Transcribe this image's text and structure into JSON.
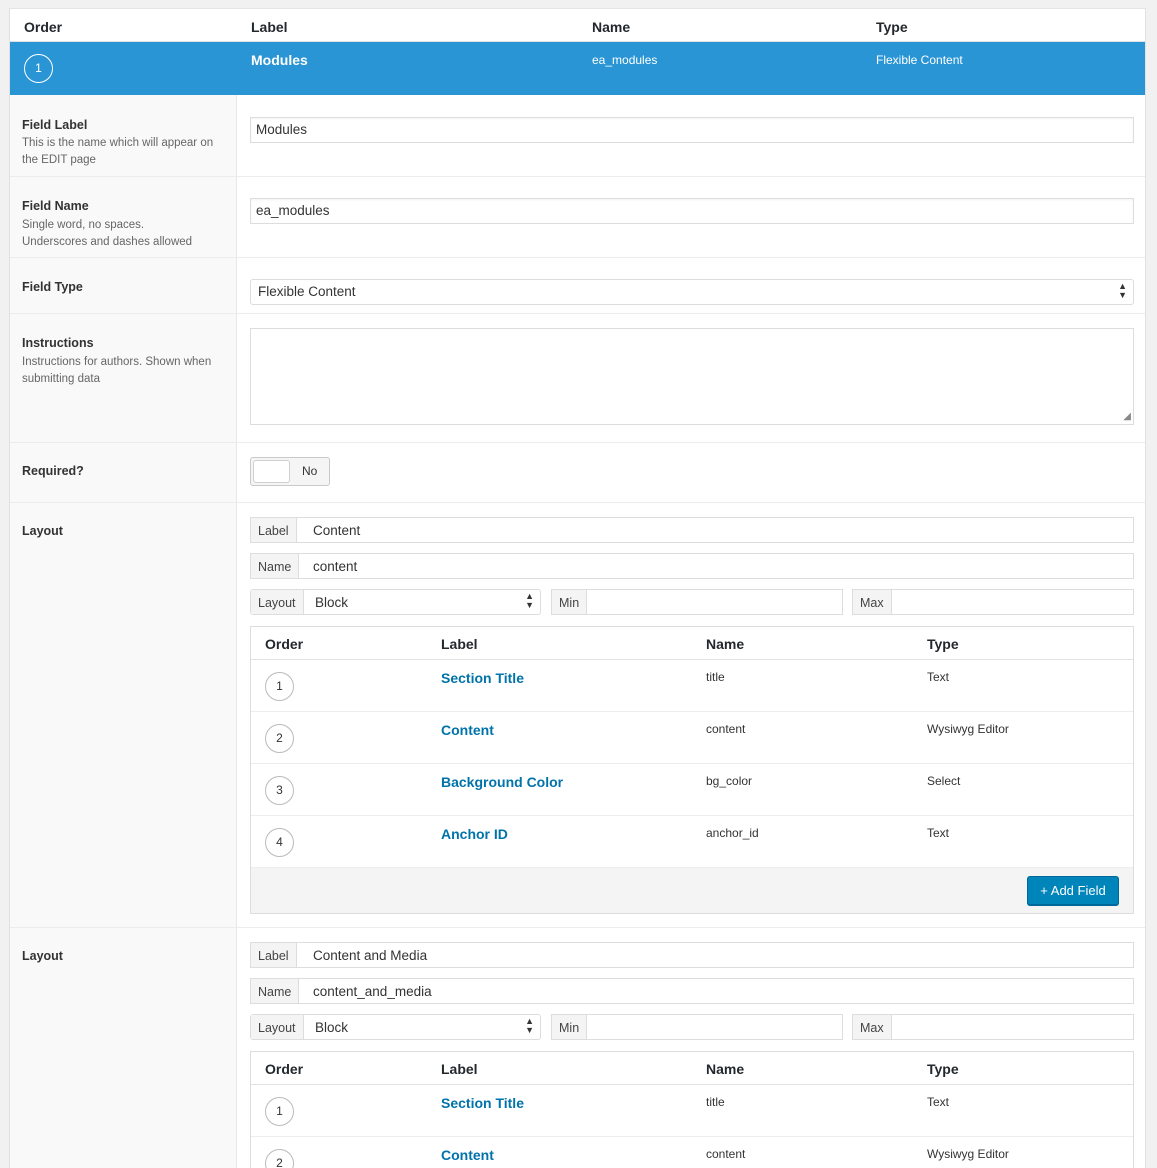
{
  "header": {
    "order": "Order",
    "label": "Label",
    "name": "Name",
    "type": "Type"
  },
  "field": {
    "order": "1",
    "label": "Modules",
    "name": "ea_modules",
    "type": "Flexible Content"
  },
  "settings": {
    "field_label": {
      "title": "Field Label",
      "desc": "This is the name which will appear on the EDIT page",
      "value": "Modules"
    },
    "field_name": {
      "title": "Field Name",
      "desc": "Single word, no spaces. Underscores and dashes allowed",
      "value": "ea_modules"
    },
    "field_type": {
      "title": "Field Type",
      "value": "Flexible Content"
    },
    "instructions": {
      "title": "Instructions",
      "desc": "Instructions for authors. Shown when submitting data",
      "value": ""
    },
    "required": {
      "title": "Required?",
      "value": "No"
    }
  },
  "layouts": [
    {
      "title": "Layout",
      "label_prefix": "Label",
      "label": "Content",
      "name_prefix": "Name",
      "name": "content",
      "layout_prefix": "Layout",
      "layout": "Block",
      "min_prefix": "Min",
      "min": "",
      "max_prefix": "Max",
      "max": "",
      "table_head": {
        "order": "Order",
        "label": "Label",
        "name": "Name",
        "type": "Type"
      },
      "fields": [
        {
          "order": "1",
          "label": "Section Title",
          "name": "title",
          "type": "Text"
        },
        {
          "order": "2",
          "label": "Content",
          "name": "content",
          "type": "Wysiwyg Editor"
        },
        {
          "order": "3",
          "label": "Background Color",
          "name": "bg_color",
          "type": "Select"
        },
        {
          "order": "4",
          "label": "Anchor ID",
          "name": "anchor_id",
          "type": "Text"
        }
      ],
      "add_button": "+ Add Field"
    },
    {
      "title": "Layout",
      "label_prefix": "Label",
      "label": "Content and Media",
      "name_prefix": "Name",
      "name": "content_and_media",
      "layout_prefix": "Layout",
      "layout": "Block",
      "min_prefix": "Min",
      "min": "",
      "max_prefix": "Max",
      "max": "",
      "table_head": {
        "order": "Order",
        "label": "Label",
        "name": "Name",
        "type": "Type"
      },
      "fields": [
        {
          "order": "1",
          "label": "Section Title",
          "name": "title",
          "type": "Text"
        },
        {
          "order": "2",
          "label": "Content",
          "name": "content",
          "type": "Wysiwyg Editor"
        }
      ]
    }
  ],
  "colors": {
    "accent": "#2a95d5",
    "link": "#0073aa",
    "button": "#0085ba"
  }
}
